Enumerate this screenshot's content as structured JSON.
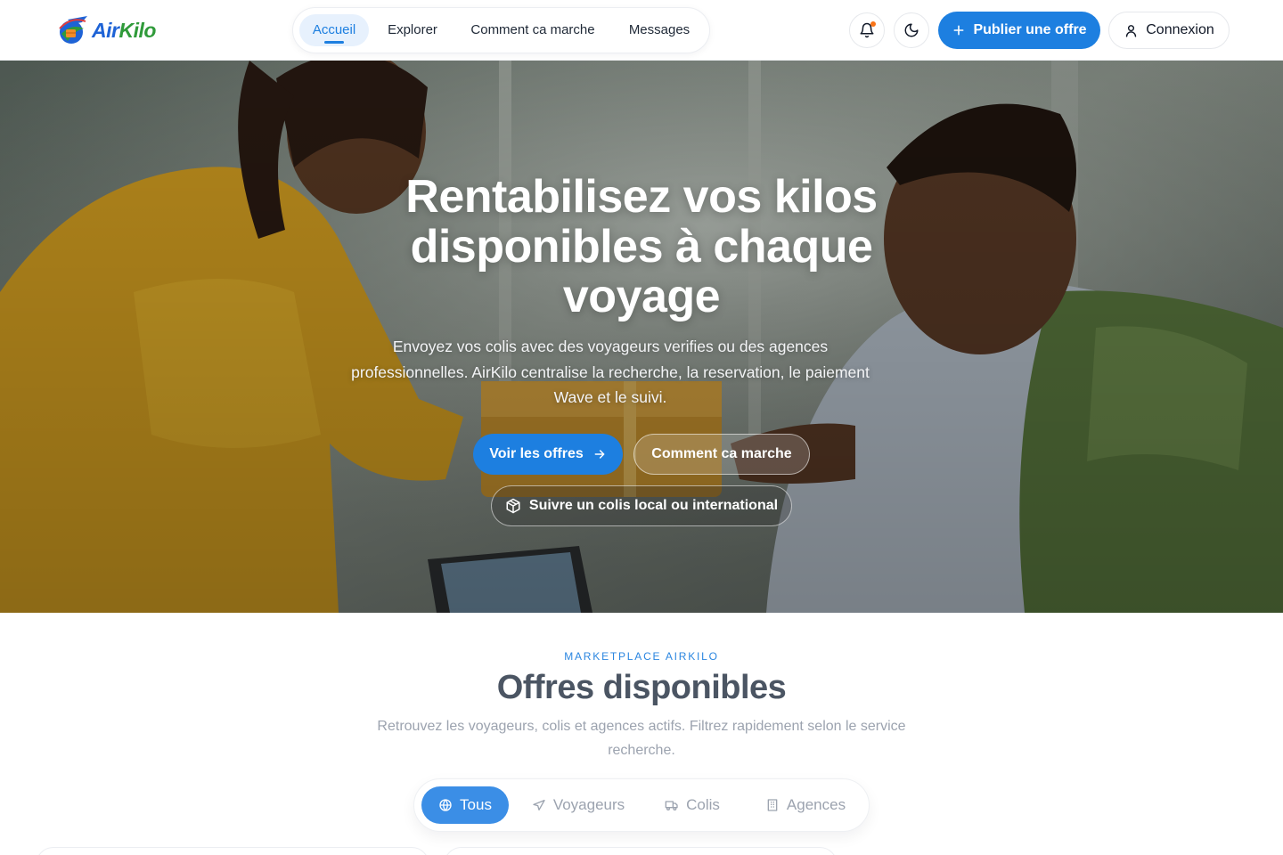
{
  "brand": {
    "air": "Air",
    "kilo": "Kilo"
  },
  "nav": {
    "items": [
      {
        "label": "Accueil",
        "active": true
      },
      {
        "label": "Explorer",
        "active": false
      },
      {
        "label": "Comment ca marche",
        "active": false
      },
      {
        "label": "Messages",
        "active": false
      }
    ]
  },
  "header_actions": {
    "notifications_icon": "bell-icon",
    "theme_icon": "moon-icon",
    "publish_label": "Publier une offre",
    "login_label": "Connexion"
  },
  "hero": {
    "title": "Rentabilisez vos kilos disponibles à chaque voyage",
    "subtitle": "Envoyez vos colis avec des voyageurs verifies ou des agences professionnelles. AirKilo centralise la recherche, la reservation, le paiement Wave et le suivi.",
    "primary_cta": "Voir les offres",
    "secondary_cta": "Comment ca marche",
    "track_cta": "Suivre un colis local ou international"
  },
  "offers": {
    "eyebrow": "MARKETPLACE AIRKILO",
    "title": "Offres disponibles",
    "subtitle": "Retrouvez les voyageurs, colis et agences actifs. Filtrez rapidement selon le service recherche.",
    "filters": [
      {
        "label": "Tous",
        "icon": "globe-icon",
        "active": true
      },
      {
        "label": "Voyageurs",
        "icon": "plane-icon",
        "active": false
      },
      {
        "label": "Colis",
        "icon": "truck-icon",
        "active": false
      },
      {
        "label": "Agences",
        "icon": "building-icon",
        "active": false
      }
    ]
  },
  "colors": {
    "accent": "#1d7fe0",
    "brand_blue": "#1e63d6",
    "brand_green": "#2f9a3a",
    "notification_dot": "#f97316"
  }
}
